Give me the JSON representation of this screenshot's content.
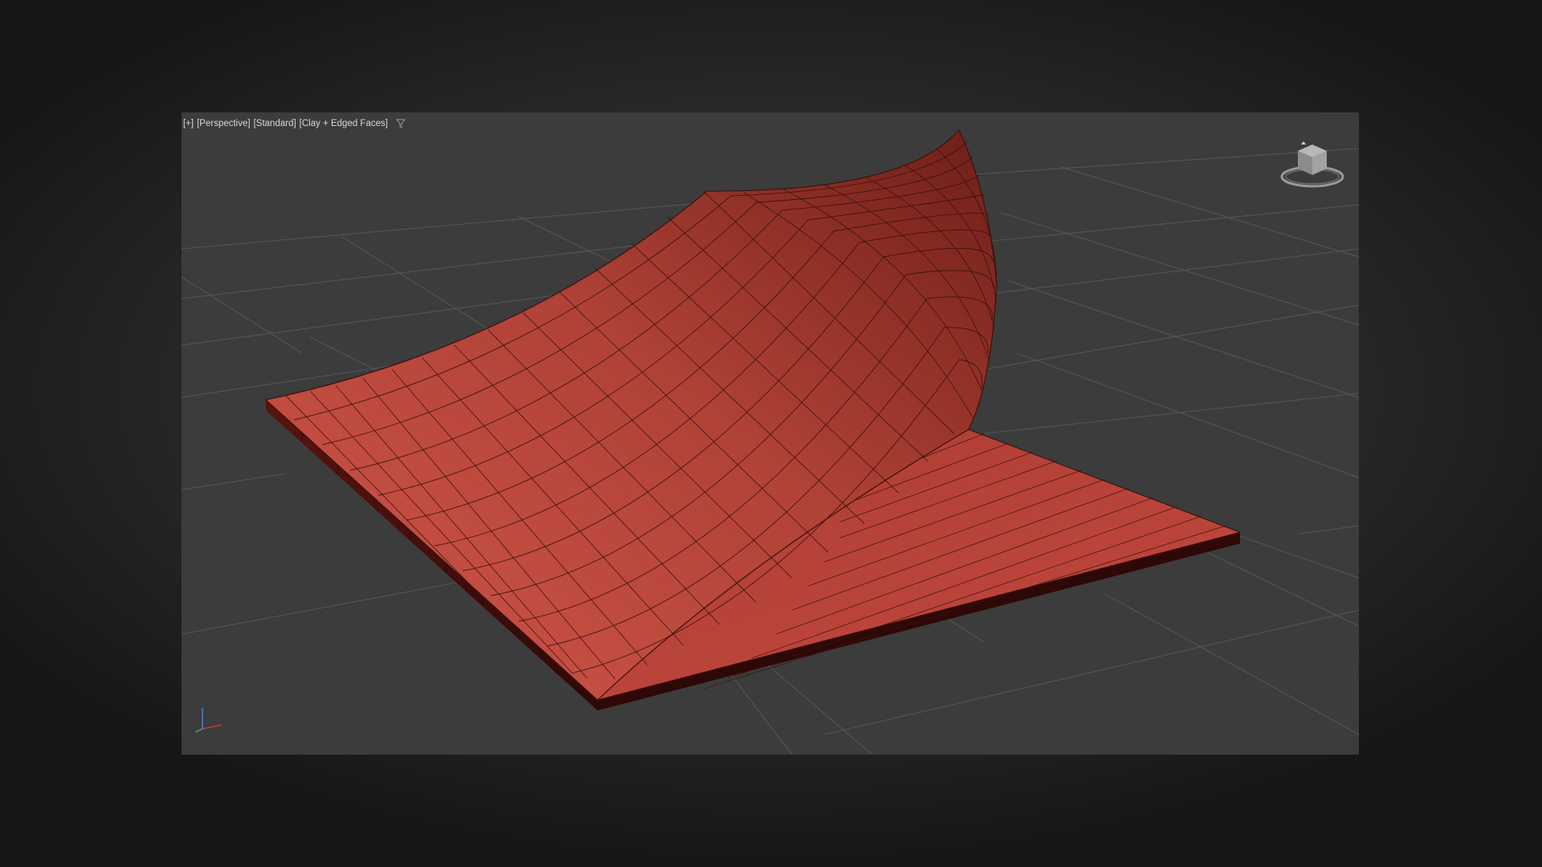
{
  "viewport": {
    "label": {
      "plus": "[+]",
      "view": "[Perspective]",
      "shading_set": "[Standard]",
      "shading_mode": "[Clay + Edged Faces]"
    },
    "icons": {
      "filter": "filter-funnel-icon",
      "viewcube": "viewcube-icon",
      "axis": "axis-tripod-icon"
    },
    "colors": {
      "background": "#3c3c3c",
      "grid_line": "#555555",
      "mesh_face": "#c0473c",
      "mesh_edge": "#3a110d",
      "slab_side": "#4a0f0b"
    }
  }
}
